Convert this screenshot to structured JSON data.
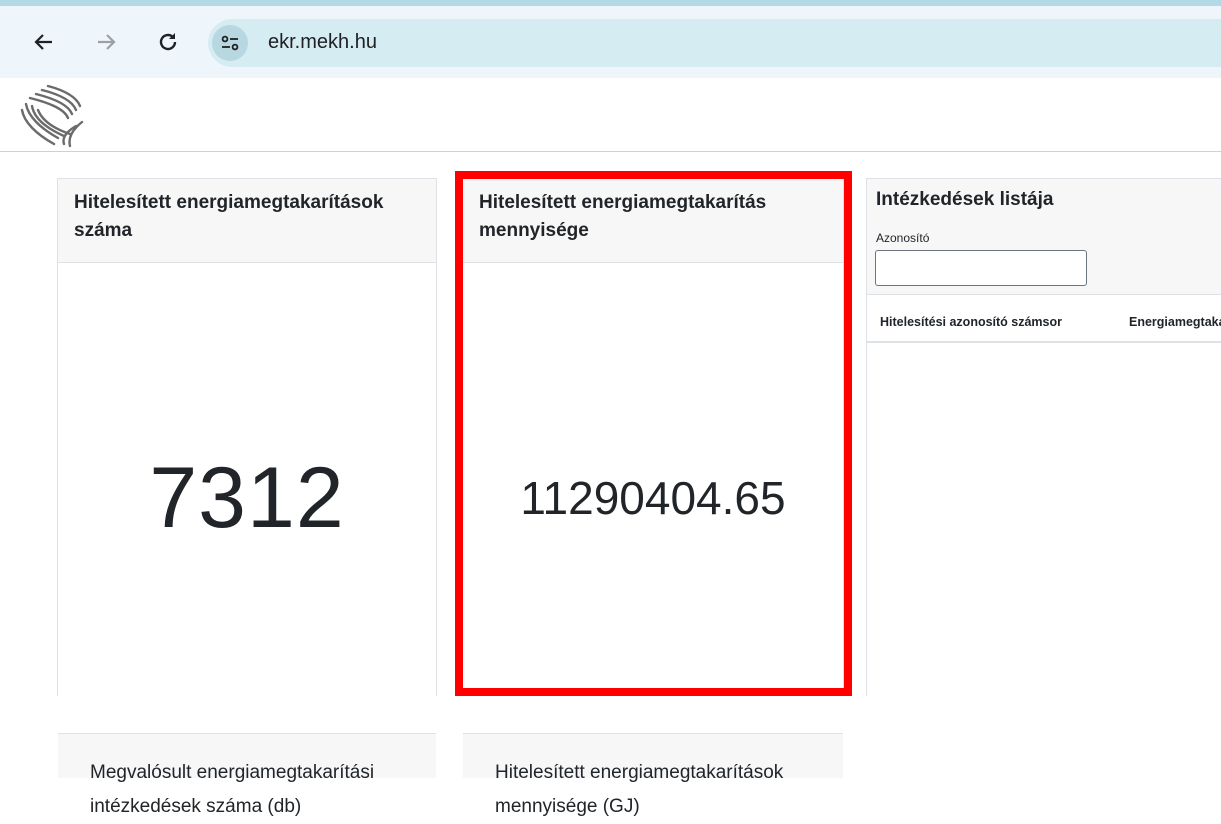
{
  "browser": {
    "url": "ekr.mekh.hu",
    "icons": [
      "back-arrow-icon",
      "forward-arrow-icon",
      "reload-icon",
      "site-settings-icon"
    ]
  },
  "cards": [
    {
      "header": "Hitelesített energiamegtakarítások száma",
      "value": "7312",
      "footer": "Megvalósult energiamegtakarítási intézkedések száma (db)"
    },
    {
      "header": "Hitelesített energiamegtakarítás mennyisége",
      "value": "11290404.65",
      "footer": "Hitelesített energiamegtakarítások mennyisége (GJ)"
    }
  ],
  "list": {
    "title": "Intézkedések listája",
    "field_label": "Azonosító",
    "field_value": "",
    "columns": [
      "Hitelesítési azonosító számsor",
      "Energiamegtakarítás"
    ]
  },
  "colors": {
    "highlight": "#ff0000",
    "browser_bar": "#eef6fb",
    "url_bar": "#d6ecf3"
  }
}
